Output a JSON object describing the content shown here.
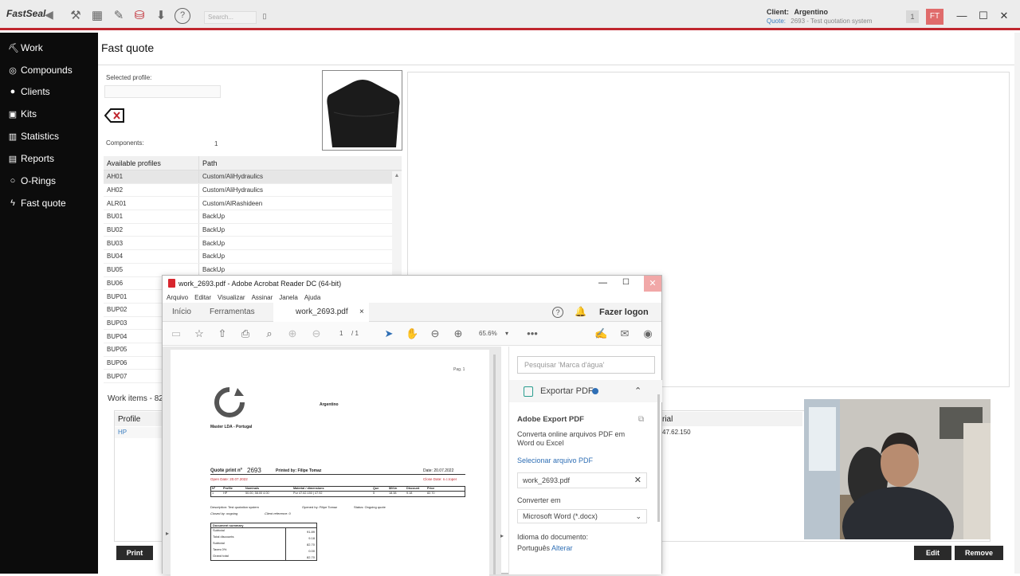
{
  "titlebar": {
    "logo": "FastSeal",
    "search_placeholder": "Search...",
    "client_label": "Client:",
    "client_value": "Argentino",
    "quote_label": "Quote:",
    "quote_value": "2693 - Test quotation system",
    "notif_count": "1",
    "user_initials": "FT"
  },
  "sidebar": {
    "items": [
      {
        "label": "Work"
      },
      {
        "label": "Compounds"
      },
      {
        "label": "Clients"
      },
      {
        "label": "Kits"
      },
      {
        "label": "Statistics"
      },
      {
        "label": "Reports"
      },
      {
        "label": "O-Rings"
      },
      {
        "label": "Fast quote"
      }
    ]
  },
  "main": {
    "title": "Fast quote",
    "selected_profile_label": "Selected profile:",
    "components_label": "Components:",
    "components_value": "1",
    "table": {
      "headers": [
        "Available profiles",
        "Path"
      ],
      "rows": [
        [
          "AH01",
          "Custom/AliHydraulics"
        ],
        [
          "AH02",
          "Custom/AliHydraulics"
        ],
        [
          "ALR01",
          "Custom/AlRashideen"
        ],
        [
          "BU01",
          "BackUp"
        ],
        [
          "BU02",
          "BackUp"
        ],
        [
          "BU03",
          "BackUp"
        ],
        [
          "BU04",
          "BackUp"
        ],
        [
          "BU05",
          "BackUp"
        ],
        [
          "BU06",
          ""
        ],
        [
          "BUP01",
          ""
        ],
        [
          "BUP02",
          ""
        ],
        [
          "BUP03",
          ""
        ],
        [
          "BUP04",
          ""
        ],
        [
          "BUP05",
          ""
        ],
        [
          "BUP06",
          ""
        ],
        [
          "BUP07",
          ""
        ]
      ]
    },
    "work_items_title": "Work items - 82.",
    "work_col_profile": "Profile",
    "work_row_profile": "HP",
    "work_col_material": "rial",
    "work_row_material": "47.62.150",
    "print_button": "Print",
    "edit_button": "Edit",
    "remove_button": "Remove"
  },
  "acrobat": {
    "title": "work_2693.pdf - Adobe Acrobat Reader DC (64-bit)",
    "menu": [
      "Arquivo",
      "Editar",
      "Visualizar",
      "Assinar",
      "Janela",
      "Ajuda"
    ],
    "tab_home": "Início",
    "tab_tools": "Ferramentas",
    "tab_doc": "work_2693.pdf",
    "logon": "Fazer logon",
    "page_current": "1",
    "page_total": "/ 1",
    "zoom": "65.6%",
    "panel": {
      "search_placeholder": "Pesquisar 'Marca d'água'",
      "export_label": "Exportar PDF",
      "export_title": "Adobe Export PDF",
      "export_desc_1": "Converta online arquivos PDF em",
      "export_desc_2": "Word ou Excel",
      "select_file": "Selecionar arquivo PDF",
      "file_name": "work_2693.pdf",
      "convert_label": "Converter em",
      "convert_value": "Microsoft Word (*.docx)",
      "lang_label": "Idioma do documento:",
      "lang_value": "Português",
      "lang_change": "Alterar"
    },
    "doc": {
      "page_label": "Pag. 1",
      "client": "Argentino",
      "company": "Master LDA - Portugal",
      "quote_print_label": "Quote print nº",
      "quote_number": "2693",
      "printed_by": "Printed by: Filipe Tomaz",
      "date": "Date: 20.07.2022",
      "open_date": "Open Date: 20.07.2022",
      "close_date": "Close Date: n.c.toper",
      "table_headers": [
        "Nº",
        "Profile",
        "Nominals",
        "Material / dimensions",
        "Que",
        "$€/Un",
        "Discount",
        "Price"
      ],
      "table_row": [
        "1",
        "HP",
        "50.00, 58.00 4.00",
        "Pur 47.62.150 | 47.92",
        "5",
        "18.38",
        "9.18",
        "82.70"
      ],
      "desc_line": "Description: Test quotation system",
      "opened_by": "Opened by: Filipe Tomaz",
      "status": "Status: Ongoing quote",
      "closed_by": "Closed by: ongoing",
      "client_reference": "Client reference: 0",
      "summary_title": "Document summary",
      "summary": [
        [
          "Subtotal",
          "91.89"
        ],
        [
          "Total discounts",
          "9.18"
        ],
        [
          "Subtotal",
          "82.70"
        ],
        [
          "Taxes 0%",
          "0.00"
        ],
        [
          "Grand total",
          "82.70"
        ]
      ]
    }
  },
  "colors": {
    "accent_red": "#c0262e",
    "sidebar_bg": "#0c0c0c",
    "link_blue": "#2f6fb5"
  }
}
